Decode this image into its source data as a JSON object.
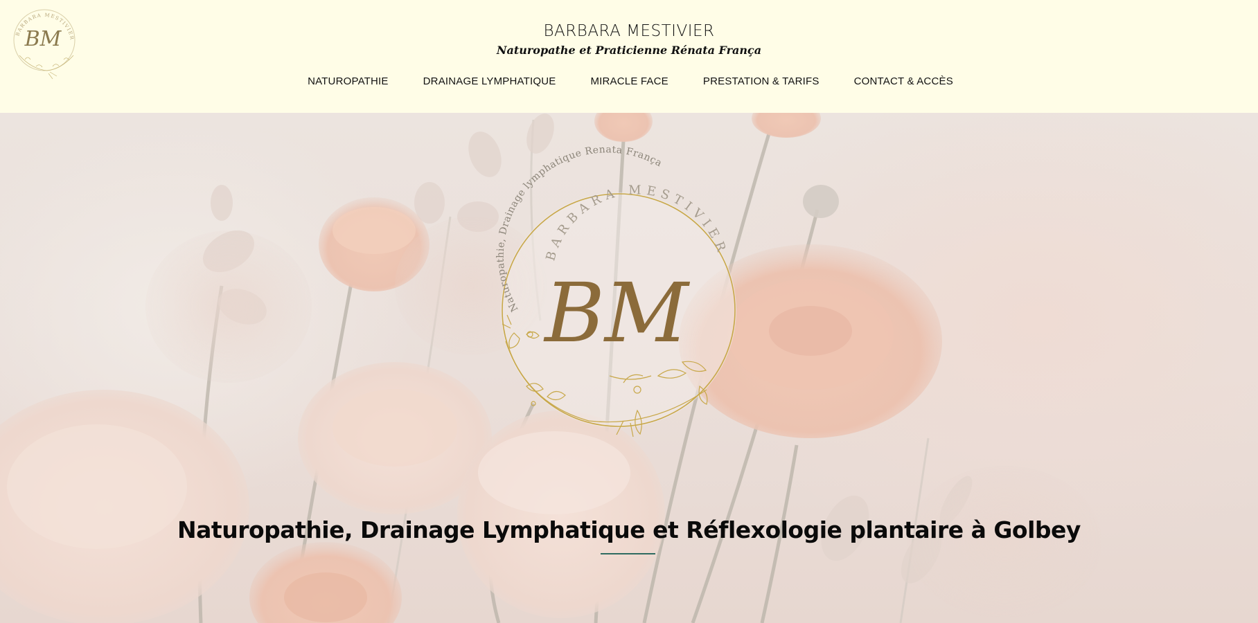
{
  "header": {
    "site_title": "BARBARA MESTIVIER",
    "site_subtitle": "Naturopathe et Praticienne Rénata França",
    "logo_initials": "BM",
    "logo_ring_text": "BARBARA MESTIVIER"
  },
  "nav": {
    "items": [
      {
        "label": "NATUROPATHIE"
      },
      {
        "label": "DRAINAGE LYMPHATIQUE"
      },
      {
        "label": "MIRACLE FACE"
      },
      {
        "label": "PRESTATION & TARIFS"
      },
      {
        "label": "CONTACT & ACCÈS"
      }
    ]
  },
  "hero": {
    "logo_outer_text": "Naturopathie, Drainage lymphatique Renata França",
    "logo_inner_text": "BARBARA MESTIVIER",
    "logo_initials": "BM",
    "headline": "Naturopathie, Drainage Lymphatique et Réflexologie plantaire à Golbey"
  },
  "colors": {
    "header_bg": "#fffde7",
    "logo_gold": "#c8a84a",
    "logo_brown": "#8b6b3a",
    "divider": "#2e6b60",
    "text": "#111111"
  },
  "icons": {
    "corner_logo": "bm-monogram-logo",
    "hero_logo": "bm-circular-floral-logo"
  }
}
